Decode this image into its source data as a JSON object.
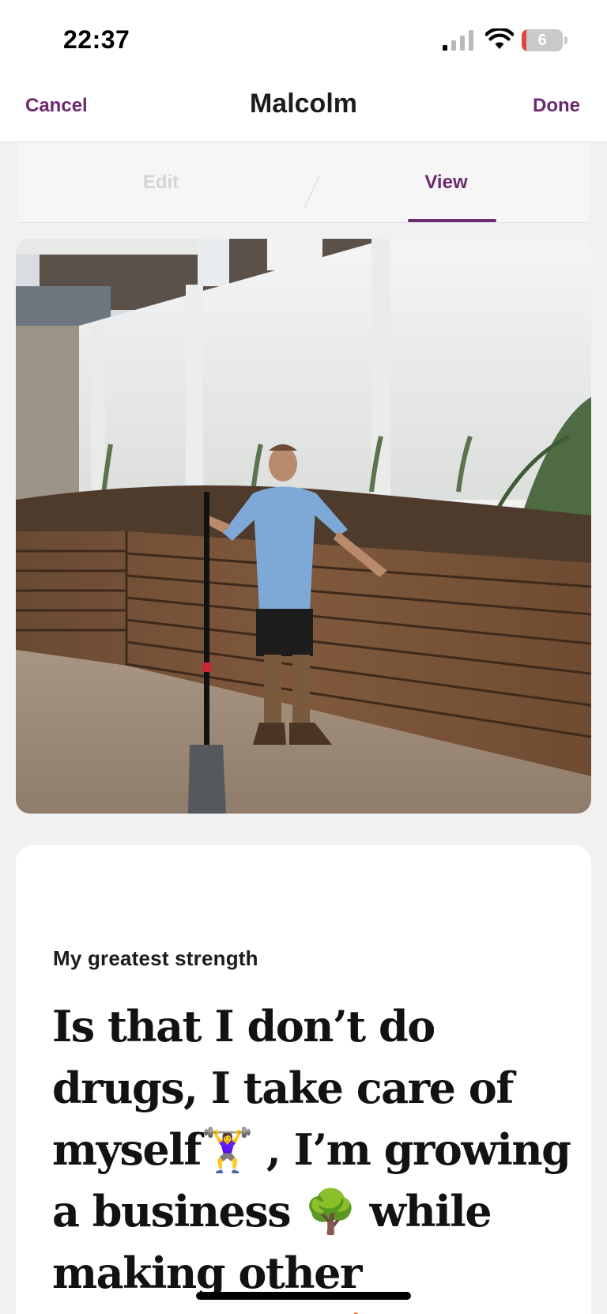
{
  "status_bar": {
    "time": "22:37",
    "signal_icon": "cellular-signal-icon",
    "wifi_icon": "wifi-icon",
    "battery_icon": "battery-icon",
    "battery_level": "6",
    "battery_fill_percent": 6
  },
  "nav": {
    "cancel_label": "Cancel",
    "title": "Malcolm",
    "done_label": "Done"
  },
  "tabs": [
    {
      "label": "Edit",
      "active": false
    },
    {
      "label": "View",
      "active": true
    }
  ],
  "photo": {
    "description_icon": "profile-photo"
  },
  "prompt_card": {
    "question": "My greatest strength",
    "answer": "Is that I don’t do drugs, I take care of myself🏋️‍♀️ , I’m growing a business 🌳 while making other investments🏠 I enjoy"
  },
  "colors": {
    "accent": "#6b2a6e",
    "background": "#f2f1f2",
    "card": "#ffffff"
  }
}
